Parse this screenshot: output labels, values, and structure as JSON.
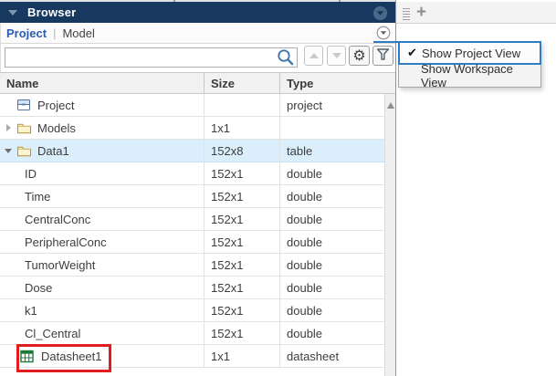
{
  "browser_panel": {
    "title": "Browser",
    "tabs": {
      "project": "Project",
      "separator": "|",
      "model": "Model"
    },
    "search": {
      "value": "",
      "placeholder": ""
    },
    "table": {
      "columns": {
        "name": "Name",
        "size": "Size",
        "type": "Type"
      },
      "rows": [
        {
          "name": "Project",
          "size": "",
          "type": "project",
          "icon": "project-box",
          "expander": "none",
          "highlighted": false
        },
        {
          "name": "Models",
          "size": "1x1",
          "type": "",
          "icon": "folder",
          "expander": "collapsed",
          "highlighted": false
        },
        {
          "name": "Data1",
          "size": "152x8",
          "type": "table",
          "icon": "folder",
          "expander": "expanded",
          "highlighted": true
        },
        {
          "name": "ID",
          "size": "152x1",
          "type": "double",
          "icon": "none",
          "expander": "none",
          "highlighted": false
        },
        {
          "name": "Time",
          "size": "152x1",
          "type": "double",
          "icon": "none",
          "expander": "none",
          "highlighted": false
        },
        {
          "name": "CentralConc",
          "size": "152x1",
          "type": "double",
          "icon": "none",
          "expander": "none",
          "highlighted": false
        },
        {
          "name": "PeripheralConc",
          "size": "152x1",
          "type": "double",
          "icon": "none",
          "expander": "none",
          "highlighted": false
        },
        {
          "name": "TumorWeight",
          "size": "152x1",
          "type": "double",
          "icon": "none",
          "expander": "none",
          "highlighted": false
        },
        {
          "name": "Dose",
          "size": "152x1",
          "type": "double",
          "icon": "none",
          "expander": "none",
          "highlighted": false
        },
        {
          "name": "k1",
          "size": "152x1",
          "type": "double",
          "icon": "none",
          "expander": "none",
          "highlighted": false
        },
        {
          "name": "Cl_Central",
          "size": "152x1",
          "type": "double",
          "icon": "none",
          "expander": "none",
          "highlighted": false
        },
        {
          "name": "Datasheet1",
          "size": "1x1",
          "type": "datasheet",
          "icon": "datasheet",
          "expander": "none",
          "highlighted": false,
          "annotated": true
        }
      ]
    }
  },
  "view_menu": {
    "check_glyph": "✔",
    "items": [
      {
        "label": "Show Project View",
        "checked": true,
        "selected": true
      },
      {
        "label": "Show Workspace View",
        "checked": false,
        "selected": false
      }
    ]
  },
  "right_panel": {
    "add_tab_glyph": "+"
  },
  "icons": {
    "gear": "⚙"
  },
  "annotation": {
    "shape": "red-rectangle",
    "target_row": "Datasheet1"
  },
  "colors": {
    "header_bg": "#17395f",
    "accent_blue": "#2e7cc4",
    "link_blue": "#2a5db4",
    "highlight_row": "#dbeefb",
    "annotation_red": "#e11d1d"
  }
}
